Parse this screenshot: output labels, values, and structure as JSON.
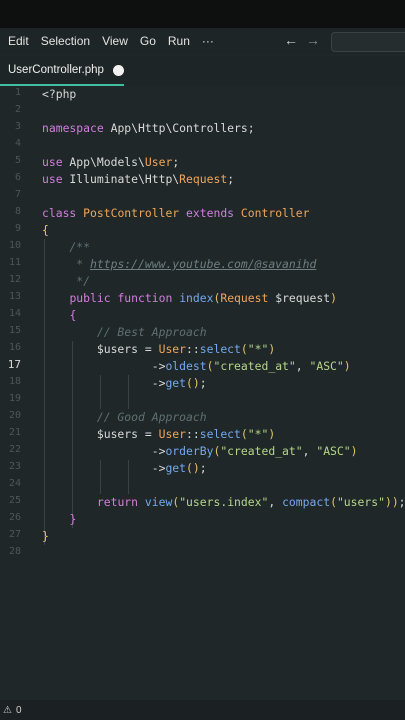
{
  "menu": {
    "items": [
      "Edit",
      "Selection",
      "View",
      "Go",
      "Run",
      "···"
    ],
    "back_icon": "←",
    "forward_icon": "→"
  },
  "tab": {
    "filename": "UserController.php"
  },
  "editor": {
    "active_line": "17",
    "line_numbers": [
      "1",
      "2",
      "3",
      "4",
      "5",
      "6",
      "7",
      "8",
      "9",
      "10",
      "11",
      "12",
      "13",
      "14",
      "15",
      "16",
      "17",
      "18",
      "19",
      "20",
      "21",
      "22",
      "23",
      "24",
      "25",
      "26",
      "27",
      "28"
    ],
    "lines": [
      "<?php",
      "",
      "namespace App\\Http\\Controllers;",
      "",
      "use App\\Models\\User;",
      "use Illuminate\\Http\\Request;",
      "",
      "class PostController extends Controller",
      "{",
      "    /**",
      "     * https://www.youtube.com/@savanihd",
      "     */",
      "    public function index(Request $request)",
      "    {",
      "        // Best Approach",
      "        $users = User::select(\"*\")",
      "                ->oldest(\"created_at\", \"ASC\")",
      "                ->get();",
      "",
      "        // Good Approach",
      "        $users = User::select(\"*\")",
      "                ->orderBy(\"created_at\", \"ASC\")",
      "                ->get();",
      "",
      "        return view(\"users.index\", compact(\"users\"));",
      "    }",
      "}",
      ""
    ]
  },
  "status": {
    "warning_icon": "⚠",
    "problems_count": "0"
  }
}
